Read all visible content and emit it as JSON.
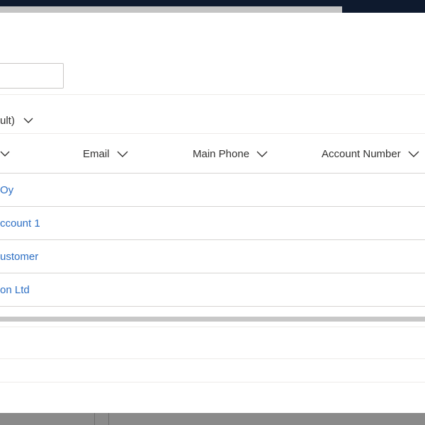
{
  "view": {
    "name_partial": "ult)"
  },
  "columns": [
    {
      "label": ""
    },
    {
      "label": "Email"
    },
    {
      "label": "Main Phone"
    },
    {
      "label": "Account Number"
    }
  ],
  "rows": [
    {
      "account_name": "Oy"
    },
    {
      "account_name": "ccount 1"
    },
    {
      "account_name": "ustomer"
    },
    {
      "account_name": "on Ltd"
    }
  ],
  "icons": {
    "sort_chevron": "chevron-down-icon"
  }
}
